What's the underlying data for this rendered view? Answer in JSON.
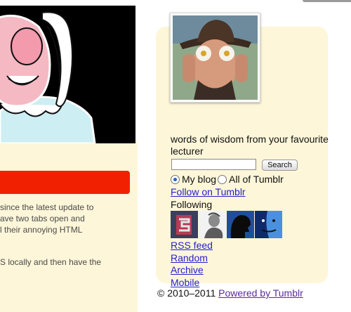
{
  "post": {
    "excerpt_lines": [
      "since the latest update to",
      "ave two tabs open and",
      "l their annoying HTML"
    ],
    "excerpt_line_2": "S locally and then have the"
  },
  "sidebar": {
    "description": "words of wisdom from your favourite lecturer",
    "search": {
      "value": "",
      "button_label": "Search"
    },
    "radio": {
      "option_my_blog": "My blog",
      "option_all": "All of Tumblr",
      "selected": "My blog"
    },
    "follow_link": "Follow on Tumblr",
    "following_heading": "Following",
    "links": [
      "RSS feed",
      "Random",
      "Archive",
      "Mobile"
    ]
  },
  "footer": {
    "copyright": "© 2010–2011",
    "powered_by": "Powered by Tumblr"
  },
  "colors": {
    "accent_red": "#f12100",
    "panel_bg": "#fdf6d9",
    "link": "#2420d0",
    "visited_link": "#5b2aa0"
  }
}
